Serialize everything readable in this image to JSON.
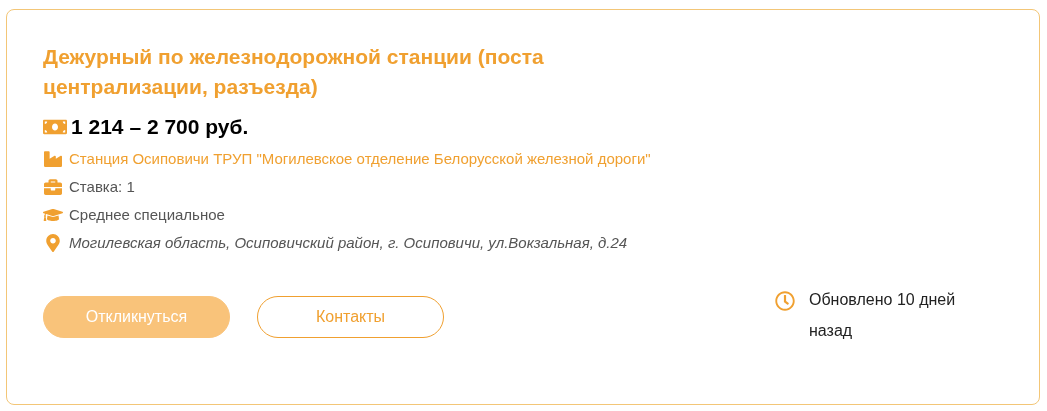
{
  "title": "Дежурный по железнодорожной станции (поста централизации, разъезда)",
  "salary": "1 214 – 2 700 руб.",
  "details": [
    {
      "kind": "company",
      "text": "Станция Осиповичи ТРУП \"Могилевское отделение Белорусской железной дороги\""
    },
    {
      "kind": "rate",
      "text": "Ставка: 1"
    },
    {
      "kind": "education",
      "text": "Среднее специальное"
    },
    {
      "kind": "address",
      "text": "Могилевская область, Осиповичский район, г. Осиповичи, ул.Вокзальная, д.24"
    }
  ],
  "buttons": [
    {
      "kind": "primary",
      "label": "Откликнуться"
    },
    {
      "kind": "outline",
      "label": "Контакты"
    }
  ],
  "updated": "Обновлено 10 дней назад"
}
